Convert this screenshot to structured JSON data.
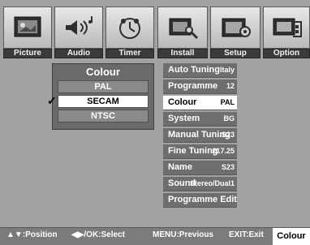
{
  "tabs": [
    {
      "label": "Picture",
      "icon": "picture-icon"
    },
    {
      "label": "Audio",
      "icon": "audio-icon"
    },
    {
      "label": "Timer",
      "icon": "timer-icon"
    },
    {
      "label": "Install",
      "icon": "install-icon"
    },
    {
      "label": "Setup",
      "icon": "setup-icon"
    },
    {
      "label": "Option",
      "icon": "option-icon"
    }
  ],
  "colour_menu": {
    "title": "Colour",
    "options": [
      "PAL",
      "SECAM",
      "NTSC"
    ],
    "selected": "SECAM",
    "check_mark": "✓"
  },
  "install_menu": {
    "items": [
      {
        "label": "Auto Tuning",
        "value": "Italy"
      },
      {
        "label": "Programme",
        "value": "12"
      },
      {
        "label": "Colour",
        "value": "PAL",
        "selected": true
      },
      {
        "label": "System",
        "value": "BG"
      },
      {
        "label": "Manual Tuning",
        "value": "S23"
      },
      {
        "label": "Fine Tuning",
        "value": "217.25"
      },
      {
        "label": "Name",
        "value": "S23"
      },
      {
        "label": "Sound",
        "value": "Stereo/Dual1"
      },
      {
        "label": "Programme Edit",
        "value": ""
      }
    ]
  },
  "footer": {
    "position_hint": "▲▼:Position",
    "select_hint": "◀▶/OK:Select",
    "menu_hint": "MENU:Previous",
    "exit_hint": "EXIT:Exit",
    "context_label": "Colour"
  },
  "colors": {
    "background": "#a2a2a2",
    "highlight": "#ffffff",
    "menu_row": "#6e6e6e",
    "tab_label": "#3b3b3b"
  }
}
